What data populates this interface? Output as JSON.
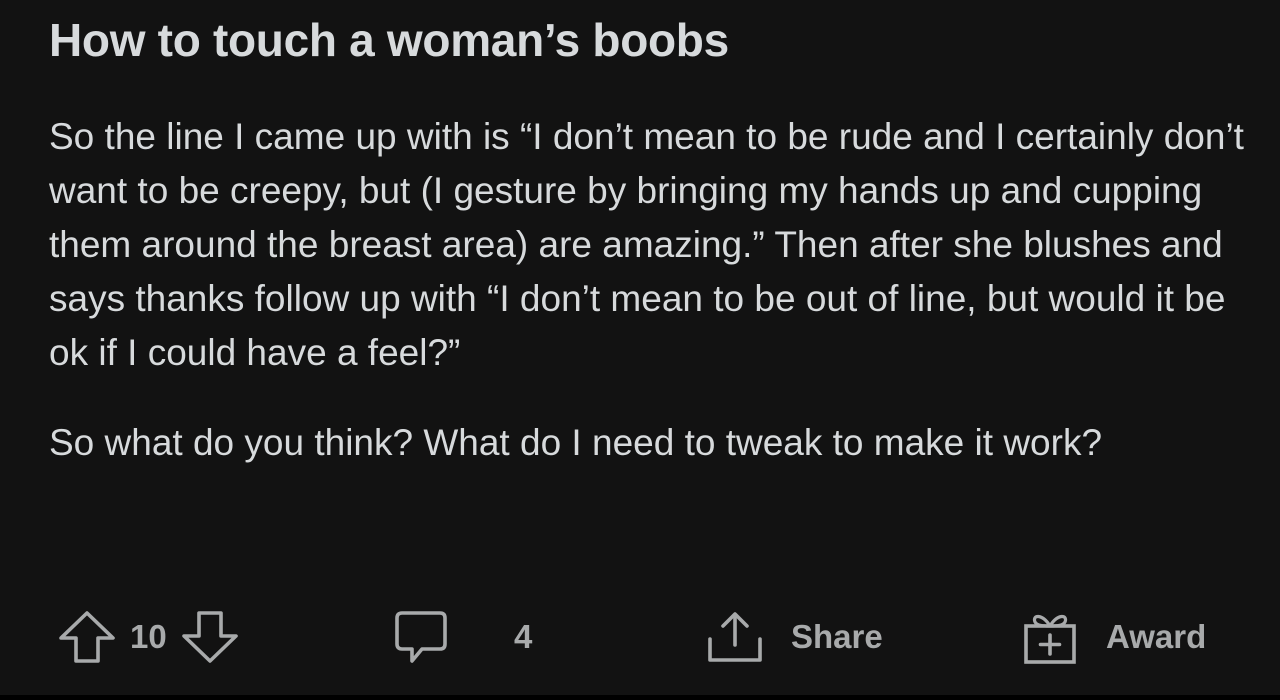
{
  "post": {
    "title": "How to touch a woman’s boobs",
    "body": [
      "So the line I came up with is “I don’t mean to be rude and I certainly don’t want to be creepy, but (I gesture by bringing my hands up and cupping them around the breast area) are amazing.” Then after she blushes and says thanks follow up with “I don’t mean to be out of line, but would it be ok if I could have a feel?”",
      "So what do you think? What do I need to tweak to make it work?"
    ]
  },
  "actions": {
    "vote_count": "10",
    "comment_count": "4",
    "share_label": "Share",
    "award_label": "Award"
  },
  "icons": {
    "upvote": "arrow-up-outline",
    "downvote": "arrow-down-outline",
    "comment": "speech-bubble",
    "share": "share-tray-arrow",
    "award": "gift-box"
  },
  "colors": {
    "background": "#121212",
    "text": "#d7dadc",
    "muted": "#a8aaab"
  }
}
